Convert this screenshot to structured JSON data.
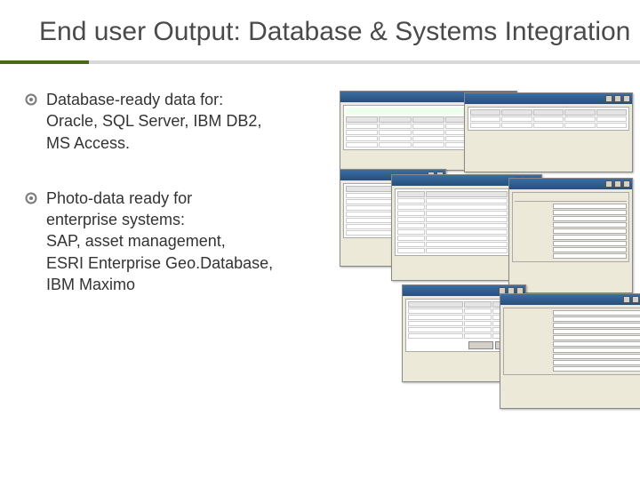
{
  "title": "End user Output: Database & Systems Integration",
  "bullets": [
    {
      "text": "Database-ready data for:\nOracle, SQL Server, IBM DB2,\nMS Access."
    },
    {
      "text": "Photo-data ready for\nenterprise systems:\nSAP, asset management,\nESRI Enterprise Geo.Database,\nIBM Maximo"
    }
  ],
  "colors": {
    "accent": "#4a6a1a",
    "rule": "#d9d9d9",
    "bullet_dot": "#7a7a7a"
  }
}
